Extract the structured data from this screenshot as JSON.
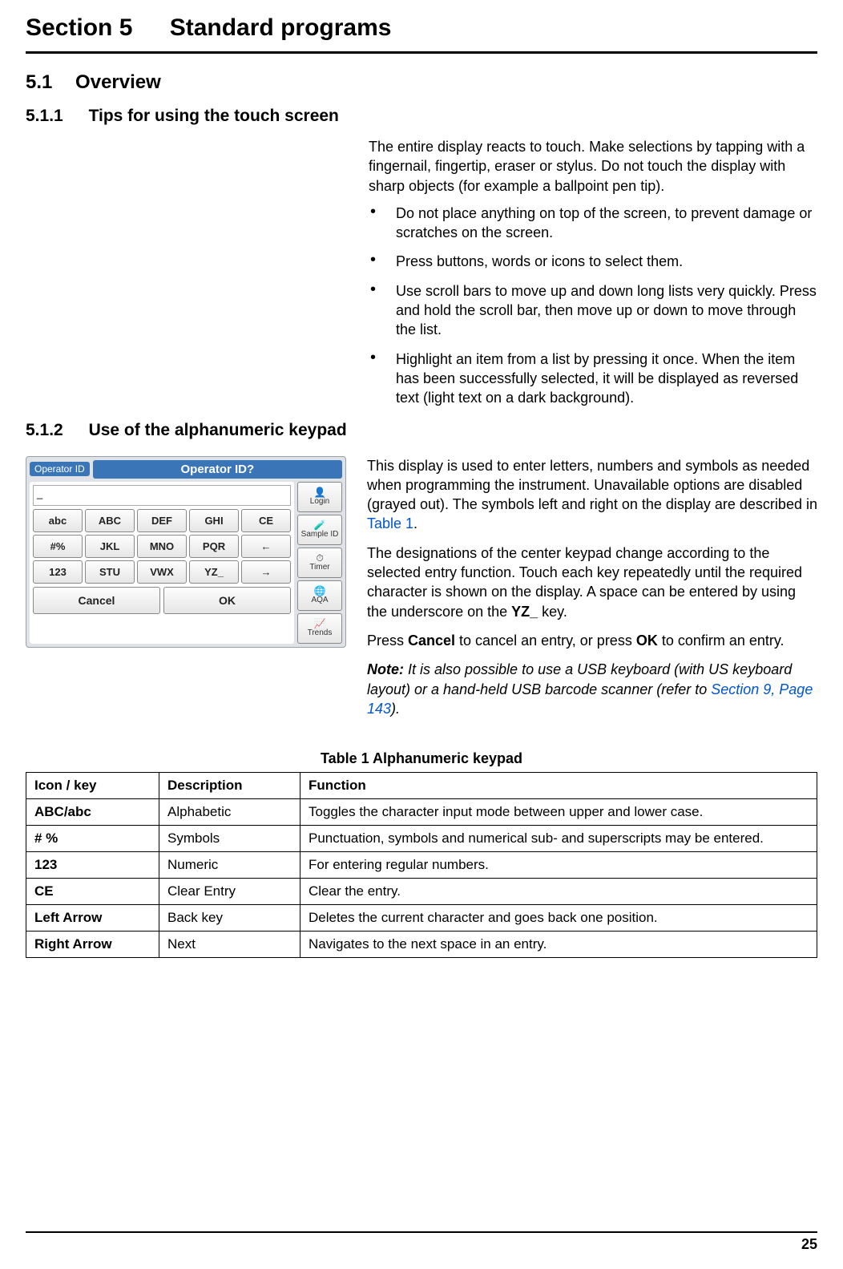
{
  "header": {
    "section_number": "Section 5",
    "section_title": "Standard programs"
  },
  "sub_5_1": {
    "number": "5.1",
    "title": "Overview"
  },
  "sub_5_1_1": {
    "number": "5.1.1",
    "title": "Tips for using the touch screen",
    "intro": "The entire display reacts to touch. Make selections by tapping with a fingernail, fingertip, eraser or stylus. Do not touch the display with sharp objects (for example a ballpoint pen tip).",
    "bullets": [
      "Do not place anything on top of the screen, to prevent damage or scratches on the screen.",
      "Press buttons, words or icons to select them.",
      "Use scroll bars to move up and down long lists very quickly. Press and hold the scroll bar, then move up or down to move through the list.",
      "Highlight an item from a list by pressing it once. When the item has been successfully selected, it will be displayed as reversed text (light text on a dark background)."
    ]
  },
  "sub_5_1_2": {
    "number": "5.1.2",
    "title": "Use of the alphanumeric keypad",
    "p1_a": "This display is used to enter letters, numbers and symbols as needed when programming the instrument. Unavailable options are disabled (grayed out). The symbols left and right on the display are described in ",
    "p1_link": "Table 1",
    "p1_b": ".",
    "p2_a": "The designations of the center keypad change according to the selected entry function. Touch each key repeatedly until the required character is shown on the display. A space can be entered by using the underscore on the ",
    "p2_bold": "YZ_",
    "p2_b": " key.",
    "p3_a": "Press ",
    "p3_cancel": "Cancel",
    "p3_mid": " to cancel an entry, or press ",
    "p3_ok": "OK",
    "p3_b": " to confirm an entry.",
    "note_label": "Note:",
    "note_a": " It is also possible to use a USB keyboard (with US keyboard layout) or a hand-held USB barcode scanner (refer to ",
    "note_link": "Section 9, Page 143",
    "note_b": ")."
  },
  "keypad_mock": {
    "operator_tag": "Operator ID",
    "title": "Operator ID?",
    "row1": [
      "abc",
      "ABC",
      "DEF",
      "GHI",
      "CE"
    ],
    "row2": [
      "#%",
      "JKL",
      "MNO",
      "PQR",
      "←"
    ],
    "row3": [
      "123",
      "STU",
      "VWX",
      "YZ_",
      "→"
    ],
    "cancel": "Cancel",
    "ok": "OK",
    "side": [
      "Login",
      "Sample ID",
      "Timer",
      "AQA",
      "Trends"
    ]
  },
  "table": {
    "caption": "Table 1 Alphanumeric keypad",
    "headers": [
      "Icon / key",
      "Description",
      "Function"
    ],
    "rows": [
      [
        "ABC/abc",
        "Alphabetic",
        "Toggles the character input mode between upper and lower case."
      ],
      [
        "# %",
        "Symbols",
        "Punctuation, symbols and numerical sub- and superscripts may be entered."
      ],
      [
        "123",
        "Numeric",
        "For entering regular numbers."
      ],
      [
        "CE",
        "Clear Entry",
        "Clear the entry."
      ],
      [
        "Left Arrow",
        "Back key",
        "Deletes the current character and goes back one position."
      ],
      [
        "Right Arrow",
        "Next",
        "Navigates to the next space in an entry."
      ]
    ]
  },
  "page_number": "25"
}
